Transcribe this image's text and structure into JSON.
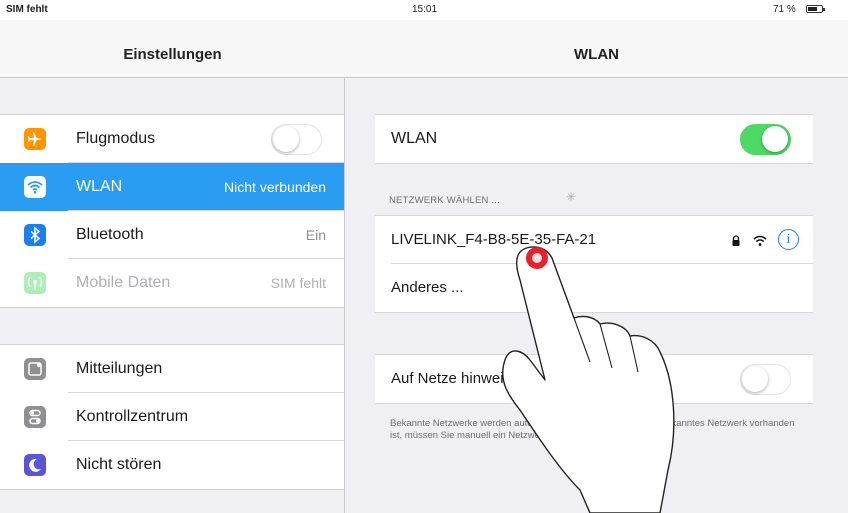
{
  "status_bar": {
    "carrier": "SIM fehlt",
    "time": "15:01",
    "battery_percent": "71 %",
    "battery_level": 0.71
  },
  "master": {
    "title": "Einstellungen",
    "group1": [
      {
        "label": "Flugmodus",
        "icon": "airplane-icon",
        "icon_color": "#ff9500",
        "toggle": "off"
      },
      {
        "label": "WLAN",
        "value": "Nicht verbunden",
        "icon": "wifi-icon",
        "icon_color": "#2a9cf2",
        "selected": true
      },
      {
        "label": "Bluetooth",
        "value": "Ein",
        "icon": "bluetooth-icon",
        "icon_color": "#1a7ff2"
      },
      {
        "label": "Mobile Daten",
        "value": "SIM fehlt",
        "icon": "cellular-icon",
        "icon_color": "#4cd964",
        "disabled": true
      }
    ],
    "group2": [
      {
        "label": "Mitteilungen",
        "icon": "notifications-icon",
        "icon_color": "#8e8e93"
      },
      {
        "label": "Kontrollzentrum",
        "icon": "control-center-icon",
        "icon_color": "#8e8e93"
      },
      {
        "label": "Nicht stören",
        "icon": "moon-icon",
        "icon_color": "#5856d6"
      }
    ]
  },
  "detail": {
    "title": "WLAN",
    "wlan_label": "WLAN",
    "wlan_toggle": "on",
    "section_header": "NETZWERK WÄHLEN ...",
    "networks": [
      {
        "name": "LIVELINK_F4-B8-5E-35-FA-21",
        "secured": true
      },
      {
        "name": "Anderes ..."
      }
    ],
    "ask_label": "Auf Netze hinweisen",
    "ask_toggle": "off",
    "footer": "Bekannte Netzwerke werden automatisch verbunden. Falls kein bekanntes Netzwerk vorhanden ist, müssen Sie manuell ein Netzwerk auswählen."
  },
  "colors": {
    "accent": "#2a9cf2",
    "toggle_on": "#4cd964",
    "tap_marker": "#e8202a"
  }
}
